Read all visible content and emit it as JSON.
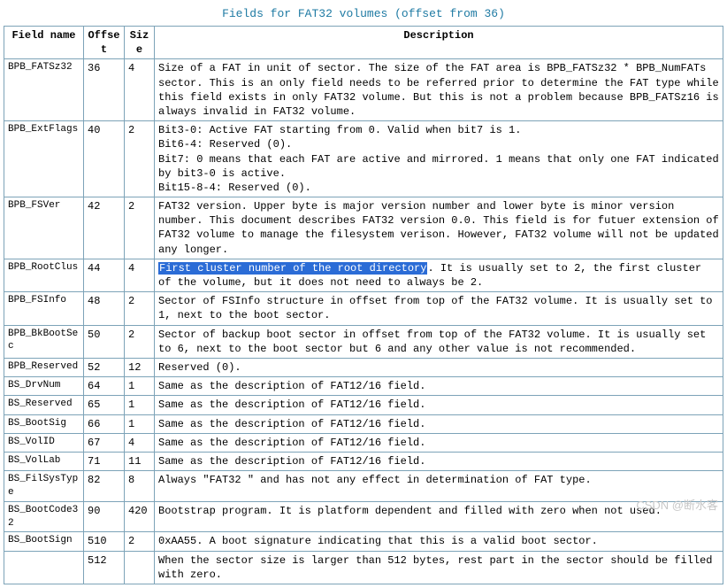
{
  "title": "Fields for FAT32 volumes (offset from 36)",
  "headers": {
    "name": "Field name",
    "offset": "Offset",
    "size": "Size",
    "desc": "Description"
  },
  "rows": [
    {
      "name": "BPB_FATSz32",
      "offset": "36",
      "size": "4",
      "desc": "Size of a FAT in unit of sector. The size of the FAT area is BPB_FATSz32 * BPB_NumFATs sector. This is an only field needs to be referred prior to determine the FAT type while this field exists in only FAT32 volume. But this is not a problem because BPB_FATSz16 is always invalid in FAT32 volume."
    },
    {
      "name": "BPB_ExtFlags",
      "offset": "40",
      "size": "2",
      "desc": "Bit3-0: Active FAT starting from 0. Valid when bit7 is 1.\nBit6-4: Reserved (0).\nBit7: 0 means that each FAT are active and mirrored. 1 means that only one FAT indicated by bit3-0 is active.\nBit15-8-4: Reserved (0)."
    },
    {
      "name": "BPB_FSVer",
      "offset": "42",
      "size": "2",
      "desc": "FAT32 version. Upper byte is major version number and lower byte is minor version number. This document describes FAT32 version 0.0. This field is for futuer extension of FAT32 volume to manage the filesystem verison. However, FAT32 volume will not be updated any longer."
    },
    {
      "name": "BPB_RootClus",
      "offset": "44",
      "size": "4",
      "desc_hl": "First cluster number of the root directory",
      "desc_rest": ". It is usually set to 2, the first cluster of the volume, but it does not need to always be 2."
    },
    {
      "name": "BPB_FSInfo",
      "offset": "48",
      "size": "2",
      "desc": "Sector of FSInfo structure in offset from top of the FAT32 volume. It is usually set to 1, next to the boot sector."
    },
    {
      "name": "BPB_BkBootSec",
      "offset": "50",
      "size": "2",
      "desc": "Sector of backup boot sector in offset from top of the FAT32 volume. It is usually set to 6, next to the boot sector but 6 and any other value is not recommended."
    },
    {
      "name": "BPB_Reserved",
      "offset": "52",
      "size": "12",
      "desc": "Reserved (0)."
    },
    {
      "name": "BS_DrvNum",
      "offset": "64",
      "size": "1",
      "desc": "Same as the description of FAT12/16 field."
    },
    {
      "name": "BS_Reserved",
      "offset": "65",
      "size": "1",
      "desc": "Same as the description of FAT12/16 field."
    },
    {
      "name": "BS_BootSig",
      "offset": "66",
      "size": "1",
      "desc": "Same as the description of FAT12/16 field."
    },
    {
      "name": "BS_VolID",
      "offset": "67",
      "size": "4",
      "desc": "Same as the description of FAT12/16 field."
    },
    {
      "name": "BS_VolLab",
      "offset": "71",
      "size": "11",
      "desc": "Same as the description of FAT12/16 field."
    },
    {
      "name": "BS_FilSysType",
      "offset": "82",
      "size": "8",
      "desc": "Always \"FAT32   \" and has not any effect in determination of FAT type."
    },
    {
      "name": "BS_BootCode32",
      "offset": "90",
      "size": "420",
      "desc": "Bootstrap program. It is platform dependent and filled with zero when not used."
    },
    {
      "name": "BS_BootSign",
      "offset": "510",
      "size": "2",
      "desc": "0xAA55. A boot signature indicating that this is a valid boot sector."
    },
    {
      "name": "",
      "offset": "512",
      "size": "",
      "desc": "When the sector size is larger than 512 bytes, rest part in the sector should be filled with zero."
    }
  ],
  "watermark": "CSDN @断水客"
}
